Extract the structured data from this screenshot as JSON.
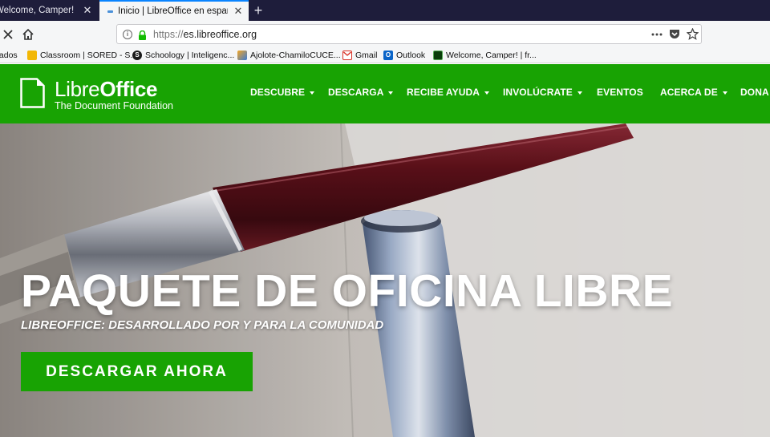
{
  "browser": {
    "tabs": [
      {
        "title": "Welcome, Camper! | freeCodeCamp",
        "active": false
      },
      {
        "title": "Inicio | LibreOffice en español",
        "active": true
      }
    ],
    "address": {
      "protocol": "https://",
      "host": "es.libreoffice.org"
    },
    "bookmarks": [
      {
        "label": "tados",
        "icon": "folder-icon"
      },
      {
        "label": "Classroom | SORED - S...",
        "icon": "classroom-icon"
      },
      {
        "label": "Schoology | Inteligenc...",
        "icon": "schoology-icon"
      },
      {
        "label": "Ajolote-ChamiloCUCE...",
        "icon": "ajolote-icon"
      },
      {
        "label": "Gmail",
        "icon": "gmail-icon"
      },
      {
        "label": "Outlook",
        "icon": "outlook-icon"
      },
      {
        "label": "Welcome, Camper! | fr...",
        "icon": "freecodecamp-icon"
      }
    ]
  },
  "site": {
    "logo": {
      "name_light": "Libre",
      "name_bold": "Office",
      "subtitle": "The Document Foundation"
    },
    "menu": [
      {
        "label": "DESCUBRE",
        "dropdown": true
      },
      {
        "label": "DESCARGA",
        "dropdown": true
      },
      {
        "label": "RECIBE AYUDA",
        "dropdown": true
      },
      {
        "label": "INVOLÚCRATE",
        "dropdown": true
      },
      {
        "label": "EVENTOS",
        "dropdown": false
      },
      {
        "label": "ACERCA DE",
        "dropdown": true
      },
      {
        "label": "DONA",
        "dropdown": false
      }
    ],
    "hero": {
      "title": "PAQUETE DE OFICINA LIBRE",
      "subtitle": "LIBREOFFICE: DESARROLLADO POR Y PARA LA COMUNIDAD",
      "cta": "DESCARGAR AHORA"
    },
    "colors": {
      "brand_green": "#18a303",
      "tab_strip": "#1e1d3b",
      "accent_blue": "#0a84ff"
    }
  }
}
